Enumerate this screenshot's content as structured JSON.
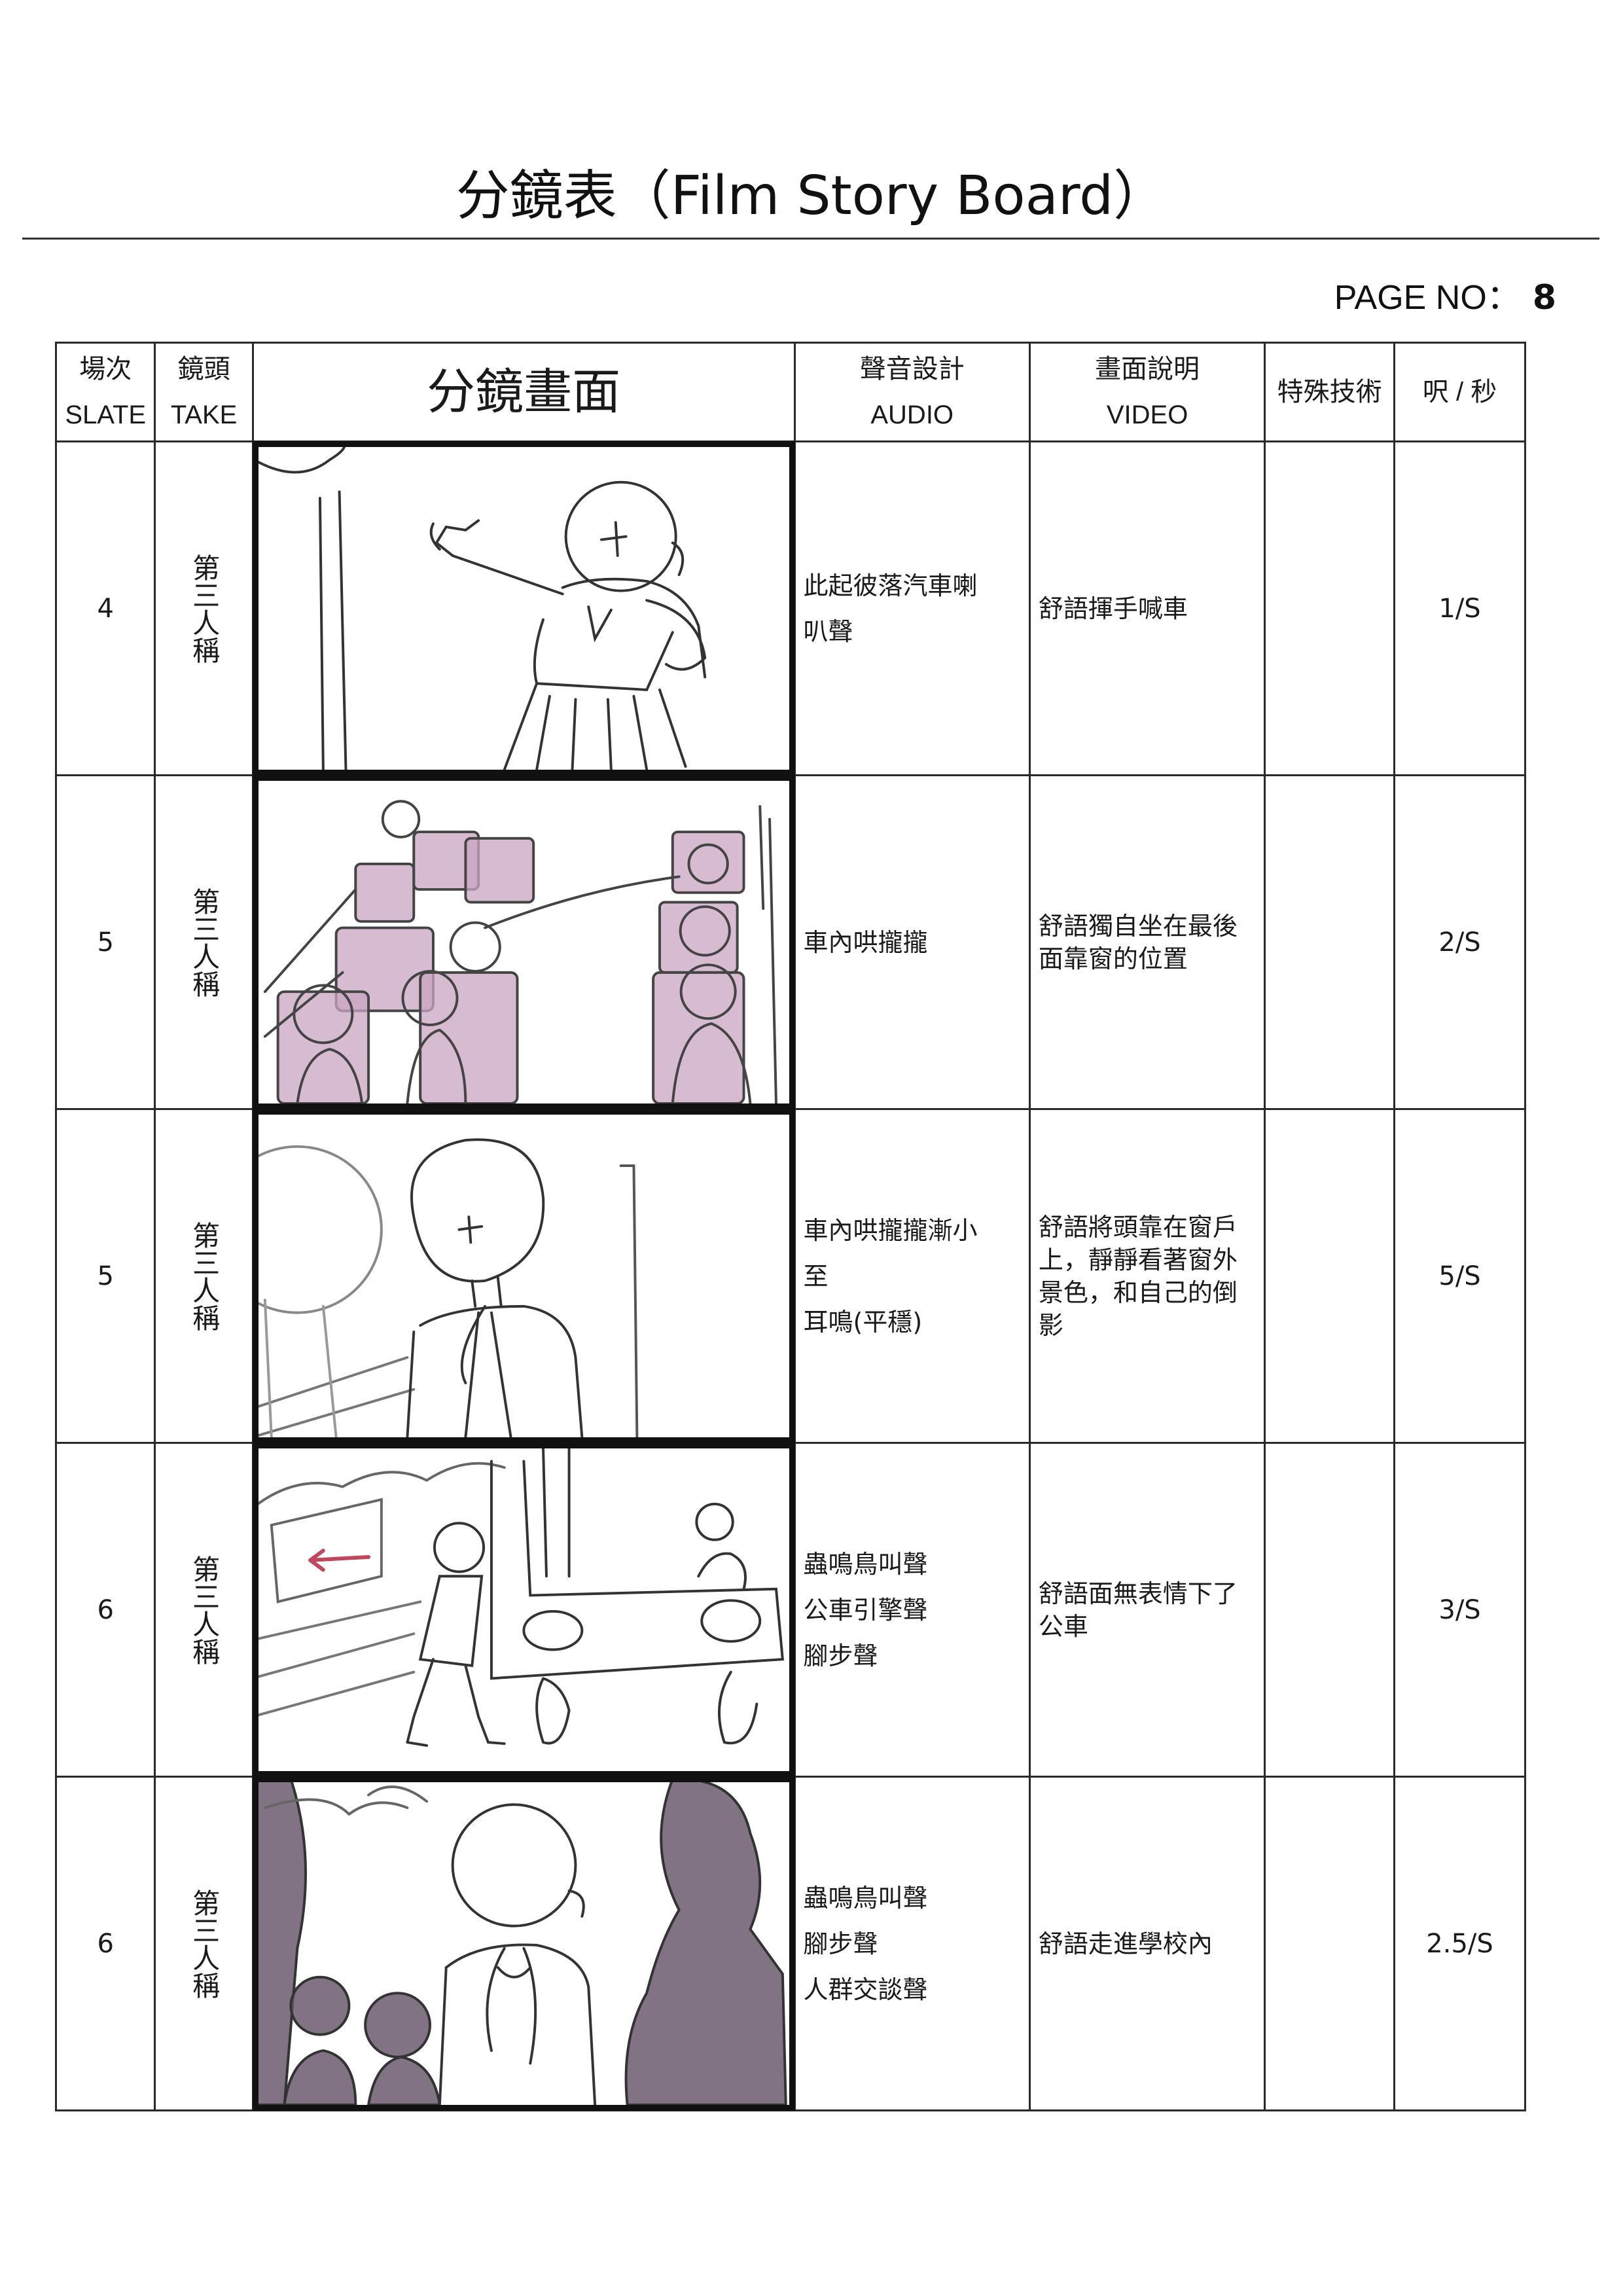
{
  "title": "分鏡表（Film Story Board）",
  "page_no": {
    "label": "PAGE NO：",
    "value": "8"
  },
  "headers": {
    "slate_zh": "場次",
    "slate_en": "SLATE",
    "take_zh": "鏡頭",
    "take_en": "TAKE",
    "frame": "分鏡畫面",
    "audio_zh": "聲音設計",
    "audio_en": "AUDIO",
    "video_zh": "畫面說明",
    "video_en": "VIDEO",
    "special": "特殊技術",
    "duration": "呎 / 秒"
  },
  "rows": [
    {
      "slate": "4",
      "take": "第三人稱",
      "audio": [
        "此起彼落汽車喇",
        "叭聲"
      ],
      "video": "舒語揮手喊車",
      "duration": "1/S"
    },
    {
      "slate": "5",
      "take": "第三人稱",
      "audio": [
        "車內哄攏攏"
      ],
      "video": "舒語獨自坐在最後面靠窗的位置",
      "duration": "2/S"
    },
    {
      "slate": "5",
      "take": "第三人稱",
      "audio": [
        "車內哄攏攏漸小",
        "至",
        "耳鳴(平穩)"
      ],
      "video": "舒語將頭靠在窗戶上，靜靜看著窗外景色，和自己的倒影",
      "duration": "5/S"
    },
    {
      "slate": "6",
      "take": "第三人稱",
      "audio": [
        "蟲鳴鳥叫聲",
        "公車引擎聲",
        "腳步聲"
      ],
      "video": "舒語面無表情下了公車",
      "duration": "3/S"
    },
    {
      "slate": "6",
      "take": "第三人稱",
      "audio": [
        "蟲鳴鳥叫聲",
        "腳步聲",
        "人群交談聲"
      ],
      "video": "舒語走進學校內",
      "duration": "2.5/S"
    }
  ],
  "colors": {
    "border": "#2a2a2a",
    "frame_border": "#111111",
    "passenger_tint": "#c9a6c2",
    "shadow_tint": "#6b5a6e",
    "arrow": "#c0485e"
  }
}
